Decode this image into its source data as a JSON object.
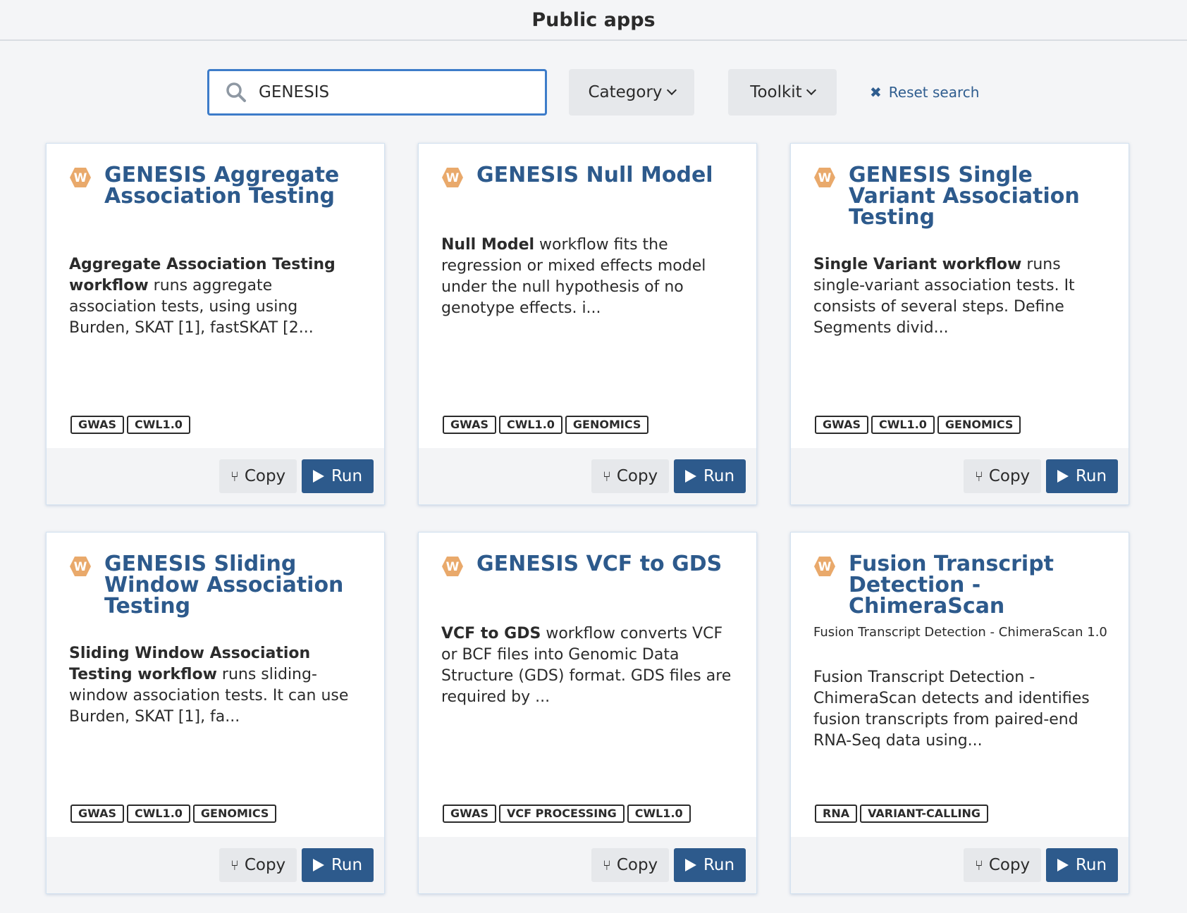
{
  "header": {
    "title": "Public apps"
  },
  "toolbar": {
    "search_value": "GENESIS",
    "category_label": "Category",
    "toolkit_label": "Toolkit",
    "reset_label": "Reset search"
  },
  "buttons": {
    "copy": "Copy",
    "run": "Run"
  },
  "icon_letter": "W",
  "colors": {
    "accent": "#2d5a8c",
    "focus_border": "#3d7cc9",
    "app_icon": "#e9a96b"
  },
  "cards": [
    {
      "title": "GENESIS Aggregate Association Testing",
      "desc_bold": "Aggregate Association Testing workflow",
      "desc_rest": " runs aggregate association tests, using using Burden, SKAT [1], fastSKAT [2...",
      "tags": [
        "GWAS",
        "CWL1.0"
      ]
    },
    {
      "title": "GENESIS Null Model",
      "desc_bold": "Null Model",
      "desc_rest": " workflow fits the regression or mixed effects model under the null hypothesis of no genotype effects. i...",
      "tags": [
        "GWAS",
        "CWL1.0",
        "GENOMICS"
      ]
    },
    {
      "title": "GENESIS Single Variant Association Testing",
      "desc_bold": "Single Variant workflow",
      "desc_rest": " runs single-variant association tests. It consists of several steps. Define Segments divid...",
      "tags": [
        "GWAS",
        "CWL1.0",
        "GENOMICS"
      ]
    },
    {
      "title": "GENESIS Sliding Window Association Testing",
      "desc_bold": "Sliding Window Association Testing workflow",
      "desc_rest": " runs sliding-window association tests. It can use Burden, SKAT [1], fa...",
      "tags": [
        "GWAS",
        "CWL1.0",
        "GENOMICS"
      ]
    },
    {
      "title": "GENESIS VCF to GDS",
      "desc_bold": "VCF to GDS",
      "desc_rest": " workflow converts VCF or BCF files into Genomic Data Structure (GDS) format. GDS files are required by ...",
      "tags": [
        "GWAS",
        "VCF PROCESSING",
        "CWL1.0"
      ]
    },
    {
      "title": "Fusion Transcript Detection - ChimeraScan",
      "meta": "Fusion Transcript Detection - ChimeraScan 1.0",
      "desc_bold": "",
      "desc_rest": "Fusion Transcript Detection - ChimeraScan detects and identifies fusion transcripts from paired-end RNA-Seq data using...",
      "tags": [
        "RNA",
        "VARIANT-CALLING"
      ]
    }
  ]
}
